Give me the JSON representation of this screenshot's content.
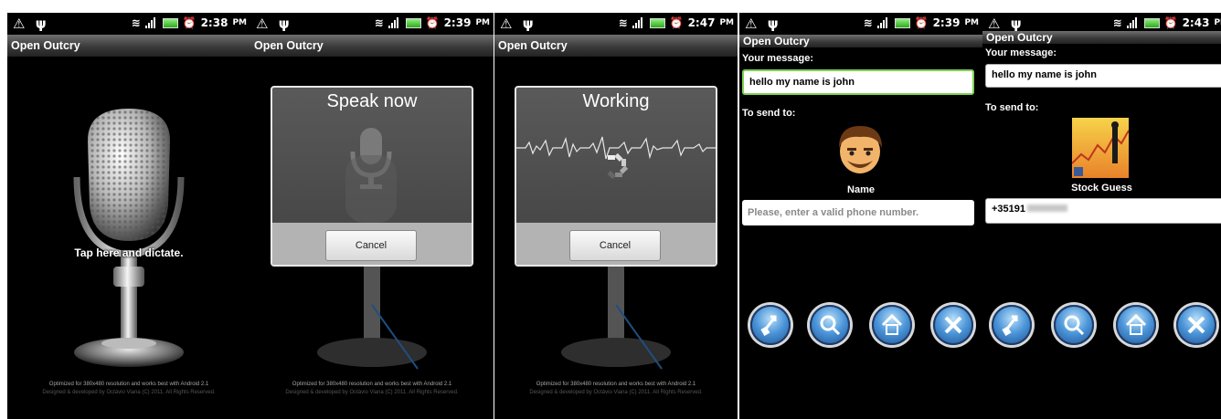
{
  "status_bar": {
    "left_icons": [
      "warning-icon",
      "usb-icon"
    ],
    "right_icons": [
      "wifi-icon",
      "signal-icon",
      "battery-icon",
      "alarm-icon"
    ]
  },
  "screens": [
    {
      "time": "2:38",
      "ampm": "PM",
      "title": "Open Outcry",
      "tap_label": "Tap here and dictate.",
      "footer_line1": "Optimized for 380x480 resolution and works best with Android 2.1",
      "footer_line2": "Designed & developed by Octávio Viana (C) 2011. All Rights Reserved."
    },
    {
      "time": "2:39",
      "ampm": "PM",
      "title": "Open Outcry",
      "dialog_title": "Speak now",
      "cancel_label": "Cancel",
      "footer_line1": "Optimized for 380x480 resolution and works best with Android 2.1",
      "footer_line2": "Designed & developed by Octávio Viana (C) 2011. All Rights Reserved."
    },
    {
      "time": "2:47",
      "ampm": "PM",
      "title": "Open Outcry",
      "dialog_title": "Working",
      "cancel_label": "Cancel",
      "footer_line1": "Optimized for 380x480 resolution and works best with Android 2.1",
      "footer_line2": "Designed & developed by Octávio Viana (C) 2011. All Rights Reserved."
    },
    {
      "time": "2:39",
      "ampm": "PM",
      "title": "Open Outcry",
      "message_label": "Your message:",
      "message_value": "hello my name is john",
      "send_label": "To send to:",
      "contact_name": "Name",
      "phone_placeholder": "Please, enter a valid phone number.",
      "phone_value": ""
    },
    {
      "time": "2:43",
      "ampm": "PM",
      "title": "Open Outcry",
      "message_label": "Your message:",
      "message_value": "hello my name is john",
      "send_label": "To send to:",
      "contact_name": "Stock Guess",
      "phone_value": "+35191"
    }
  ],
  "action_buttons": [
    "send-icon",
    "search-icon",
    "home-icon",
    "close-icon"
  ]
}
